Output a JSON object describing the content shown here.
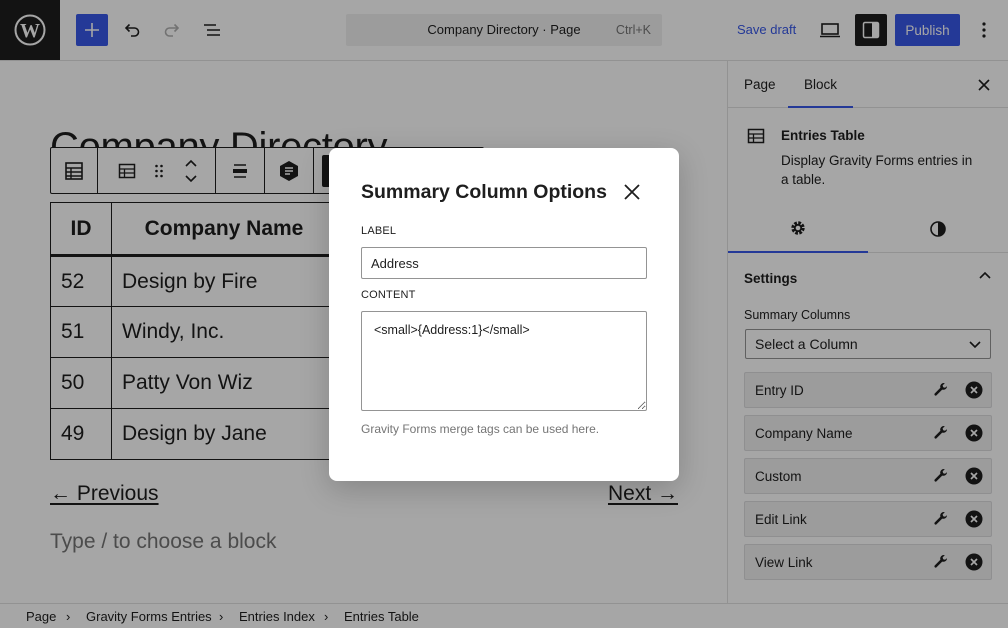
{
  "topbar": {
    "command_title": "Company Directory · Page",
    "command_shortcut": "Ctrl+K",
    "save_draft": "Save draft",
    "publish": "Publish",
    "icons": [
      "wordpress-logo-icon",
      "plus-icon",
      "undo-icon",
      "redo-icon",
      "document-overview-icon",
      "desktop-view-icon",
      "sidebar-icon",
      "more-vertical-icon"
    ]
  },
  "canvas": {
    "page_title": "Company Directory",
    "table": {
      "headers": [
        "ID",
        "Company Name"
      ],
      "rows": [
        [
          "52",
          "Design by Fire"
        ],
        [
          "51",
          "Windy, Inc."
        ],
        [
          "50",
          "Patty Von Wiz"
        ],
        [
          "49",
          "Design by Jane"
        ]
      ]
    },
    "prev_link": "← Previous",
    "next_link": "Next →",
    "appender_placeholder": "Type / to choose a block"
  },
  "sidebar": {
    "tabs": [
      "Page",
      "Block"
    ],
    "active_tab": "Block",
    "block": {
      "title": "Entries Table",
      "description": "Display Gravity Forms entries in a table."
    },
    "settings_title": "Settings",
    "summary_columns_label": "Summary Columns",
    "select_placeholder": "Select a Column",
    "columns": [
      "Entry ID",
      "Company Name",
      "Custom",
      "Edit Link",
      "View Link"
    ]
  },
  "breadcrumb": [
    "Page",
    "Gravity Forms Entries",
    "Entries Index",
    "Entries Table"
  ],
  "modal": {
    "title": "Summary Column Options",
    "label_field_label": "LABEL",
    "label_value": "Address",
    "content_field_label": "CONTENT",
    "content_value": "<small>{Address:1}</small>",
    "help_text": "Gravity Forms merge tags can be used here."
  },
  "colors": {
    "accent": "#3858e9",
    "dark": "#1e1e1e",
    "overlay": "rgba(0,0,0,0.35)"
  }
}
